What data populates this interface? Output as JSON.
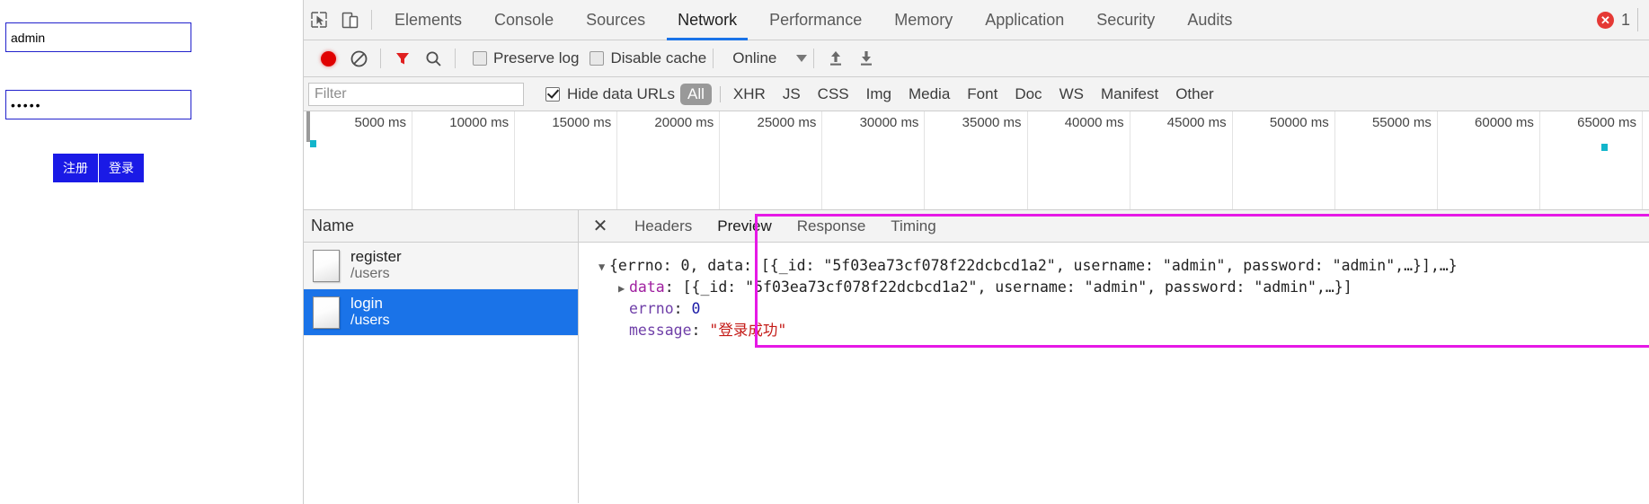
{
  "page": {
    "username_value": "admin",
    "username_placeholder": "",
    "password_value": "•••••",
    "password_placeholder": "",
    "register_label": "注册",
    "login_label": "登录",
    "button_color": "#1a1ae6",
    "input_border_color": "#2222cc"
  },
  "devtools": {
    "inspect_icon": "inspect-cursor-icon",
    "device_icon": "device-toolbar-icon",
    "tabs": [
      {
        "label": "Elements",
        "active": false
      },
      {
        "label": "Console",
        "active": false
      },
      {
        "label": "Sources",
        "active": false
      },
      {
        "label": "Network",
        "active": true
      },
      {
        "label": "Performance",
        "active": false
      },
      {
        "label": "Memory",
        "active": false
      },
      {
        "label": "Application",
        "active": false
      },
      {
        "label": "Security",
        "active": false
      },
      {
        "label": "Audits",
        "active": false
      }
    ],
    "error_badge": {
      "glyph": "✕",
      "count": "1",
      "color": "#e53935"
    },
    "network_toolbar": {
      "record_icon": "record-stop-icon",
      "clear_icon": "clear-network-icon",
      "filter_icon": "filter-funnel-icon",
      "search_icon": "search-icon",
      "preserve_log_label": "Preserve log",
      "preserve_log_checked": false,
      "disable_cache_label": "Disable cache",
      "disable_cache_checked": false,
      "throttle_value": "Online",
      "import_icon": "import-har-icon",
      "export_icon": "export-har-icon"
    },
    "filter_row": {
      "filter_placeholder": "Filter",
      "filter_value": "",
      "hide_data_urls_label": "Hide data URLs",
      "hide_data_urls_checked": true,
      "types": [
        {
          "label": "All",
          "selected": true
        },
        {
          "label": "XHR",
          "selected": false
        },
        {
          "label": "JS",
          "selected": false
        },
        {
          "label": "CSS",
          "selected": false
        },
        {
          "label": "Img",
          "selected": false
        },
        {
          "label": "Media",
          "selected": false
        },
        {
          "label": "Font",
          "selected": false
        },
        {
          "label": "Doc",
          "selected": false
        },
        {
          "label": "WS",
          "selected": false
        },
        {
          "label": "Manifest",
          "selected": false
        },
        {
          "label": "Other",
          "selected": false
        }
      ]
    },
    "overview": {
      "ticks": [
        "5000 ms",
        "10000 ms",
        "15000 ms",
        "20000 ms",
        "25000 ms",
        "30000 ms",
        "35000 ms",
        "40000 ms",
        "45000 ms",
        "50000 ms",
        "55000 ms",
        "60000 ms",
        "65000 ms"
      ],
      "marker_color": "#12b5cb",
      "markers_x_px": [
        7,
        1444
      ]
    },
    "requests": {
      "header": "Name",
      "rows": [
        {
          "name": "register",
          "path": "/users",
          "selected": false
        },
        {
          "name": "login",
          "path": "/users",
          "selected": true
        }
      ]
    },
    "detail": {
      "close_glyph": "✕",
      "tabs": [
        {
          "label": "Headers",
          "active": false
        },
        {
          "label": "Preview",
          "active": true
        },
        {
          "label": "Response",
          "active": false
        },
        {
          "label": "Timing",
          "active": false
        }
      ],
      "highlight_color": "#e619e6",
      "preview": {
        "line1": {
          "triangle": "▼",
          "text": "{errno: 0, data: [{_id: \"5f03ea73cf078f22dcbcd1a2\", username: \"admin\", password: \"admin\",…}],…}"
        },
        "line2": {
          "triangle": "▶",
          "key": "data",
          "value": "[{_id: \"5f03ea73cf078f22dcbcd1a2\", username: \"admin\", password: \"admin\",…}]"
        },
        "line3": {
          "key": "errno",
          "value": "0"
        },
        "line4": {
          "key": "message",
          "value": "\"登录成功\""
        }
      }
    }
  }
}
